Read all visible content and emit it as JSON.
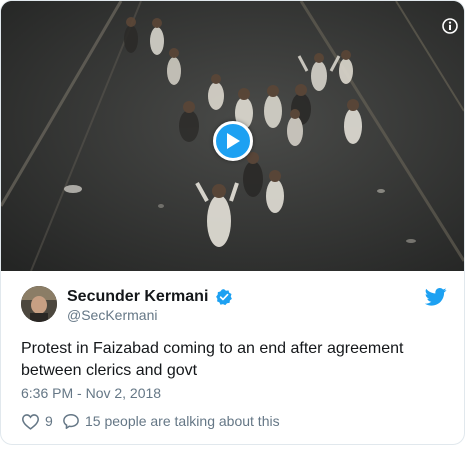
{
  "tweet": {
    "author": {
      "display_name": "Secunder Kermani",
      "handle": "@SecKermani",
      "verified": true
    },
    "text": "Protest in Faizabad coming to an end after agreement between clerics and govt",
    "timestamp": "6:36 PM - Nov 2, 2018",
    "likes": "9",
    "conversation": "15 people are talking about this"
  },
  "media": {
    "type": "video",
    "play_icon": "play-icon",
    "info_icon": "info-icon"
  },
  "icons": {
    "brand": "twitter-bird-icon",
    "verified": "verified-badge-icon",
    "like": "heart-icon",
    "reply": "speech-bubble-icon"
  },
  "colors": {
    "accent": "#1da1f2",
    "text": "#14171a",
    "secondary_text": "#657786",
    "border": "#e1e8ed"
  }
}
